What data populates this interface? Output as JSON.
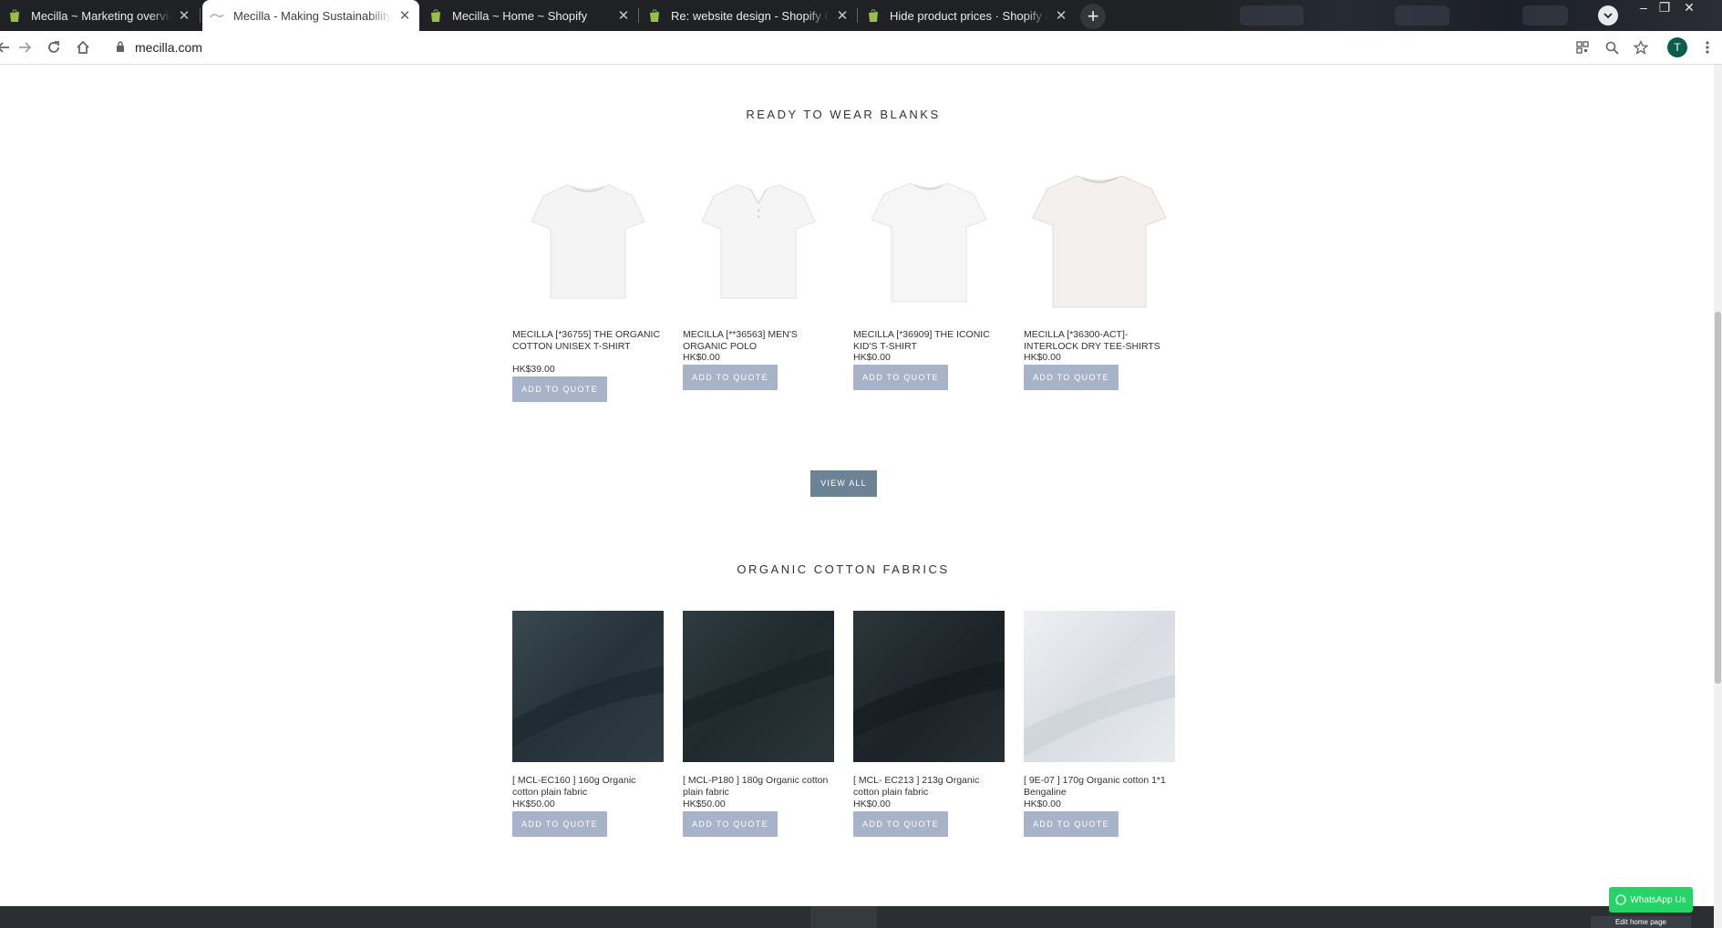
{
  "browser": {
    "tabs": [
      {
        "title": "Mecilla ~ Marketing overview ~ Shopify",
        "favicon": "shopify-icon",
        "active": false
      },
      {
        "title": "Mecilla - Making Sustainability",
        "favicon": "mecilla-icon",
        "active": true
      },
      {
        "title": "Mecilla ~ Home ~ Shopify",
        "favicon": "shopify-icon",
        "active": false
      },
      {
        "title": "Re: website design - Shopify Community",
        "favicon": "shopify-icon",
        "active": false
      },
      {
        "title": "Hide product prices · Shopify Help Center",
        "favicon": "shopify-icon",
        "active": false
      }
    ],
    "url": "mecilla.com",
    "profile_initial": "T",
    "colors": {
      "tabstrip": "#202124",
      "toolbar": "#ffffff",
      "shopify_green": "#5e8e3e"
    }
  },
  "page": {
    "sections": [
      {
        "title": "READY TO WEAR BLANKS",
        "products": [
          {
            "name": "MECILLA [*36755] THE ORGANIC COTTON UNISEX T-SHIRT",
            "price": "HK$39.00",
            "button": "ADD TO QUOTE",
            "image": "white-crew-tshirt"
          },
          {
            "name": "MECILLA [**36563] MEN'S ORGANIC POLO",
            "price": "HK$0.00",
            "button": "ADD TO QUOTE",
            "image": "white-polo"
          },
          {
            "name": "MECILLA [*36909] THE ICONIC KID'S T-SHIRT",
            "price": "HK$0.00",
            "button": "ADD TO QUOTE",
            "image": "white-kids-tshirt"
          },
          {
            "name": "MECILLA [*36300-ACT]-INTERLOCK DRY TEE-SHIRTS",
            "price": "HK$0.00",
            "button": "ADD TO QUOTE",
            "image": "offwhite-tshirt"
          }
        ],
        "view_all": "VIEW ALL"
      },
      {
        "title": "ORGANIC COTTON FABRICS",
        "products": [
          {
            "name": "[ MCL-EC160 ] 160g Organic cotton plain fabric",
            "price": "HK$50.00",
            "button": "ADD TO QUOTE",
            "image": "dark-fabric"
          },
          {
            "name": "[ MCL-P180 ] 180g Organic cotton plain fabric",
            "price": "HK$50.00",
            "button": "ADD TO QUOTE",
            "image": "dark-fabric"
          },
          {
            "name": "[ MCL- EC213 ] 213g Organic cotton plain fabric",
            "price": "HK$0.00",
            "button": "ADD TO QUOTE",
            "image": "dark-fabric"
          },
          {
            "name": "[ 9E-07 ] 170g Organic cotton 1*1 Bengaline",
            "price": "HK$0.00",
            "button": "ADD TO QUOTE",
            "image": "white-fabric"
          }
        ]
      }
    ],
    "whatsapp_label": "WhatsApp Us",
    "edit_home_label": "Edit home page",
    "colors": {
      "quote_button": "#a7b3c9",
      "view_all": "#6c8396",
      "footer": "#2b2f33",
      "whatsapp": "#25d366"
    }
  }
}
